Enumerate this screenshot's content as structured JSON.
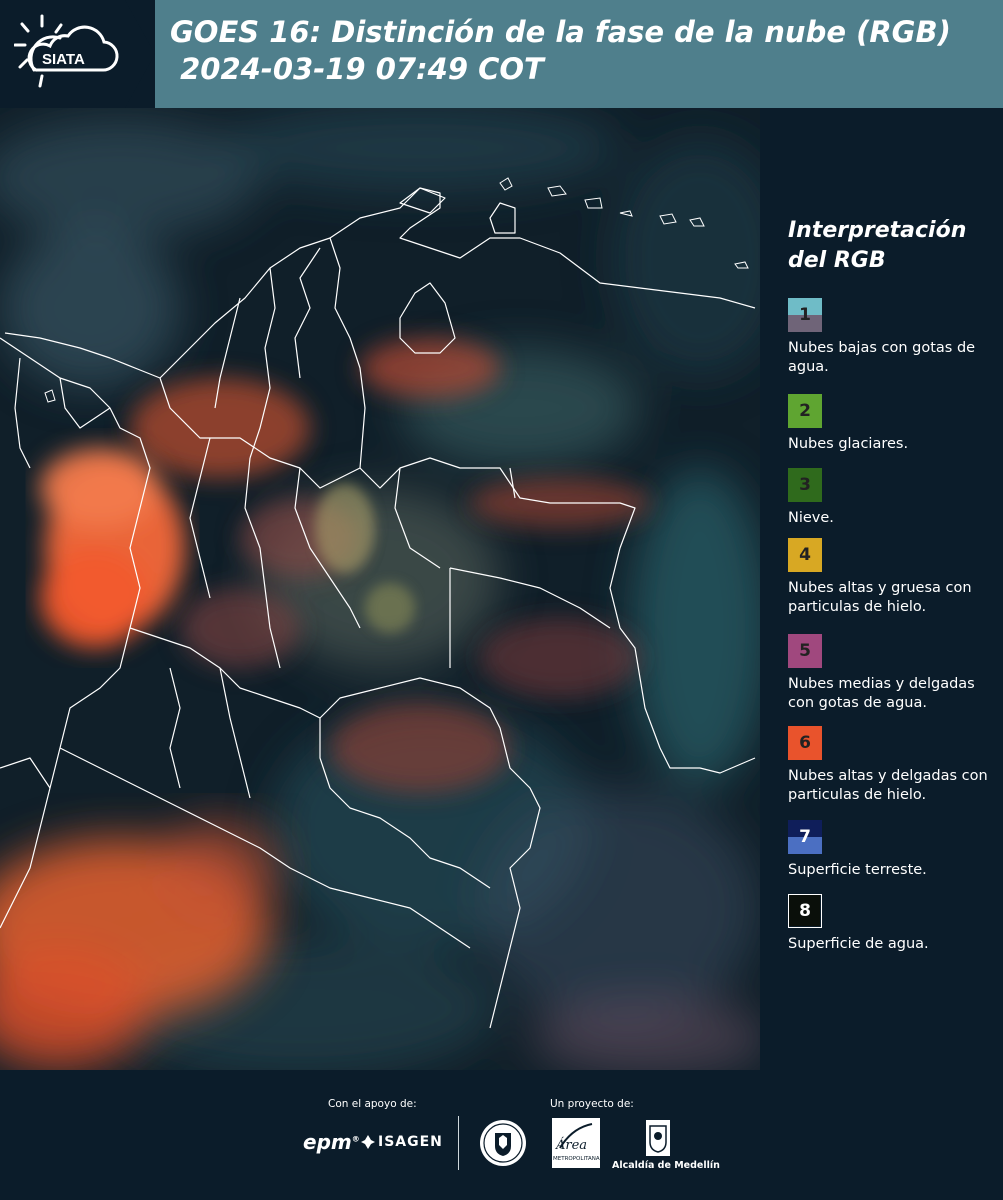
{
  "header": {
    "logo_text": "SIATA",
    "title_line1": "GOES 16: Distinción de la fase de la nube (RGB)",
    "title_line2": " 2024-03-19 07:49 COT"
  },
  "legend": {
    "title": "Interpretación del RGB",
    "items": [
      {
        "number": "1",
        "label": "Nubes bajas con gotas de agua.",
        "color_top": "#6fbcc7",
        "color_bottom": "#6f6478"
      },
      {
        "number": "2",
        "label": "Nubes glaciares.",
        "color_top": "#5fa531",
        "color_bottom": "#5fa531"
      },
      {
        "number": "3",
        "label": "Nieve.",
        "color_top": "#2f6a1c",
        "color_bottom": "#2f6a1c"
      },
      {
        "number": "4",
        "label": "Nubes altas y gruesa con particulas de hielo.",
        "color_top": "#d8a823",
        "color_bottom": "#d8a823"
      },
      {
        "number": "5",
        "label": "Nubes medias y delgadas con gotas de agua.",
        "color_top": "#a0487e",
        "color_bottom": "#a0487e"
      },
      {
        "number": "6",
        "label": "Nubes altas y delgadas con particulas de hielo.",
        "color_top": "#e9532c",
        "color_bottom": "#e9532c"
      },
      {
        "number": "7",
        "label": "Superficie terreste.",
        "color_top": "#0f1e5a",
        "color_bottom": "#4b6fc2"
      },
      {
        "number": "8",
        "label": "Superficie de agua.",
        "color_top": "#0a0f0a",
        "color_bottom": "#0a0f0a"
      }
    ]
  },
  "footer": {
    "support_label": "Con el apoyo de:",
    "project_label": "Un proyecto de:",
    "sponsor_1": "epm",
    "sponsor_2": "ISAGEN",
    "partner_1_text": "Área",
    "partner_1_sub": "METROPOLITANA",
    "partner_2": "Alcaldía de Medellín"
  },
  "colors": {
    "header_bg": "#4f7f8c",
    "panel_bg": "#0b1c2a"
  }
}
